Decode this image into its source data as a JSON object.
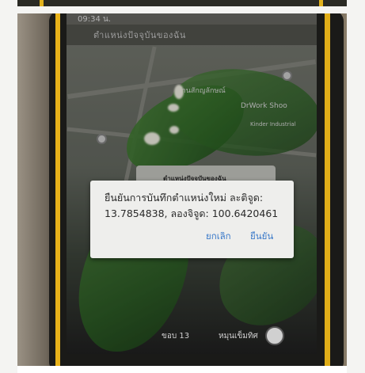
{
  "status_bar": {
    "time": "09:34 น."
  },
  "app_bar": {
    "title": "ตำแหน่งปัจจุบันของฉัน"
  },
  "map": {
    "labels": [
      {
        "text": "บ้านสักญลักษณ์"
      },
      {
        "text": "DrWork Shoo"
      },
      {
        "text": "Kinder Industrial"
      }
    ]
  },
  "background_dialog": {
    "title": "ตำแหน่งปัจจุบันของฉัน"
  },
  "dialog": {
    "line1": "ยืนยันการบันทึกตำแหน่งใหม่ ละติจูด:",
    "line2": "13.7854838, ลองจิจูด: 100.6420461",
    "cancel_label": "ยกเลิก",
    "confirm_label": "ยืนยัน",
    "accent_color": "#3a79c9"
  },
  "bottom_bar": {
    "left_label": "ขอบ 13",
    "right_label": "หมุนเข็มทิศ"
  }
}
